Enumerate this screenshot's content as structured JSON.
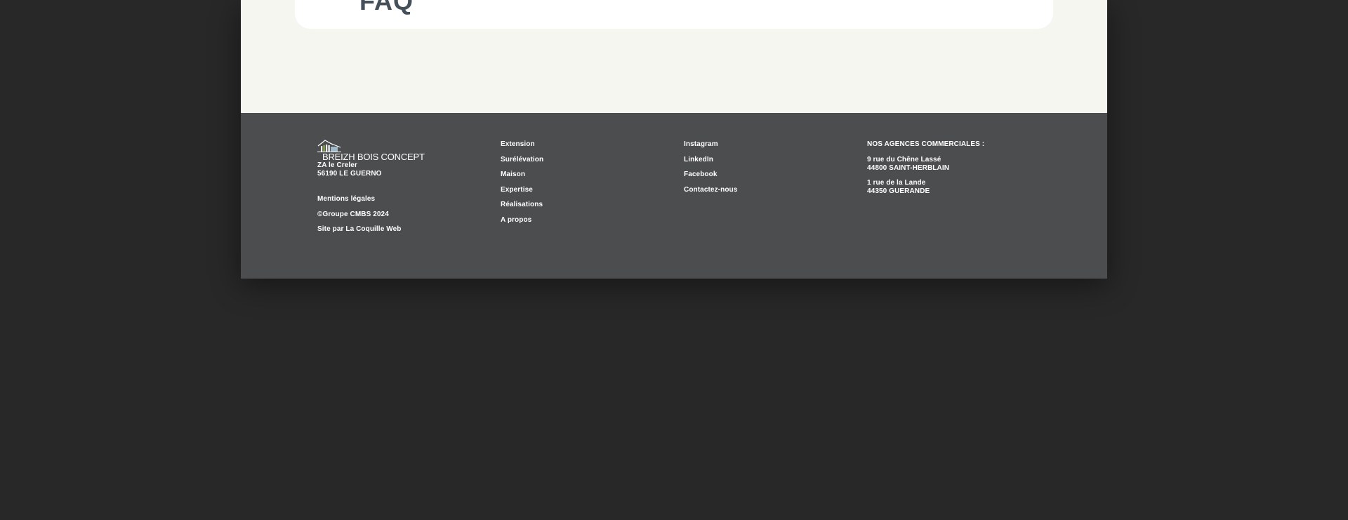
{
  "card": {
    "heading": "FAQ"
  },
  "footer": {
    "brand": {
      "name": "BREIZH BOIS CONCEPT",
      "logo_icon": "house-roof-icon",
      "accent": "#8cb04a"
    },
    "address": {
      "line1": "ZA le Creler",
      "line2": "56190 LE GUERNO"
    },
    "legal": {
      "mentions": "Mentions légales",
      "copyright": "©Groupe CMBS 2024",
      "credit": "Site par La Coquille Web"
    },
    "nav": [
      {
        "label": "Extension"
      },
      {
        "label": "Surélévation"
      },
      {
        "label": "Maison"
      },
      {
        "label": "Expertise"
      },
      {
        "label": "Réalisations"
      },
      {
        "label": "A propos"
      }
    ],
    "social": [
      {
        "label": "Instagram"
      },
      {
        "label": "LinkedIn"
      },
      {
        "label": "Facebook"
      },
      {
        "label": "Contactez-nous"
      }
    ],
    "agencies": {
      "title": "NOS AGENCES COMMERCIALES :",
      "list": [
        {
          "street": "9 rue du Chêne Lassé",
          "city": "44800 SAINT-HERBLAIN"
        },
        {
          "street": "1 rue de la Lande",
          "city": "44350 GUERANDE"
        }
      ]
    }
  },
  "colors": {
    "background": "#282828",
    "page": "#f6f6f1",
    "footer": "#4c4d4f",
    "card": "#ffffff",
    "heading": "#46505a"
  }
}
